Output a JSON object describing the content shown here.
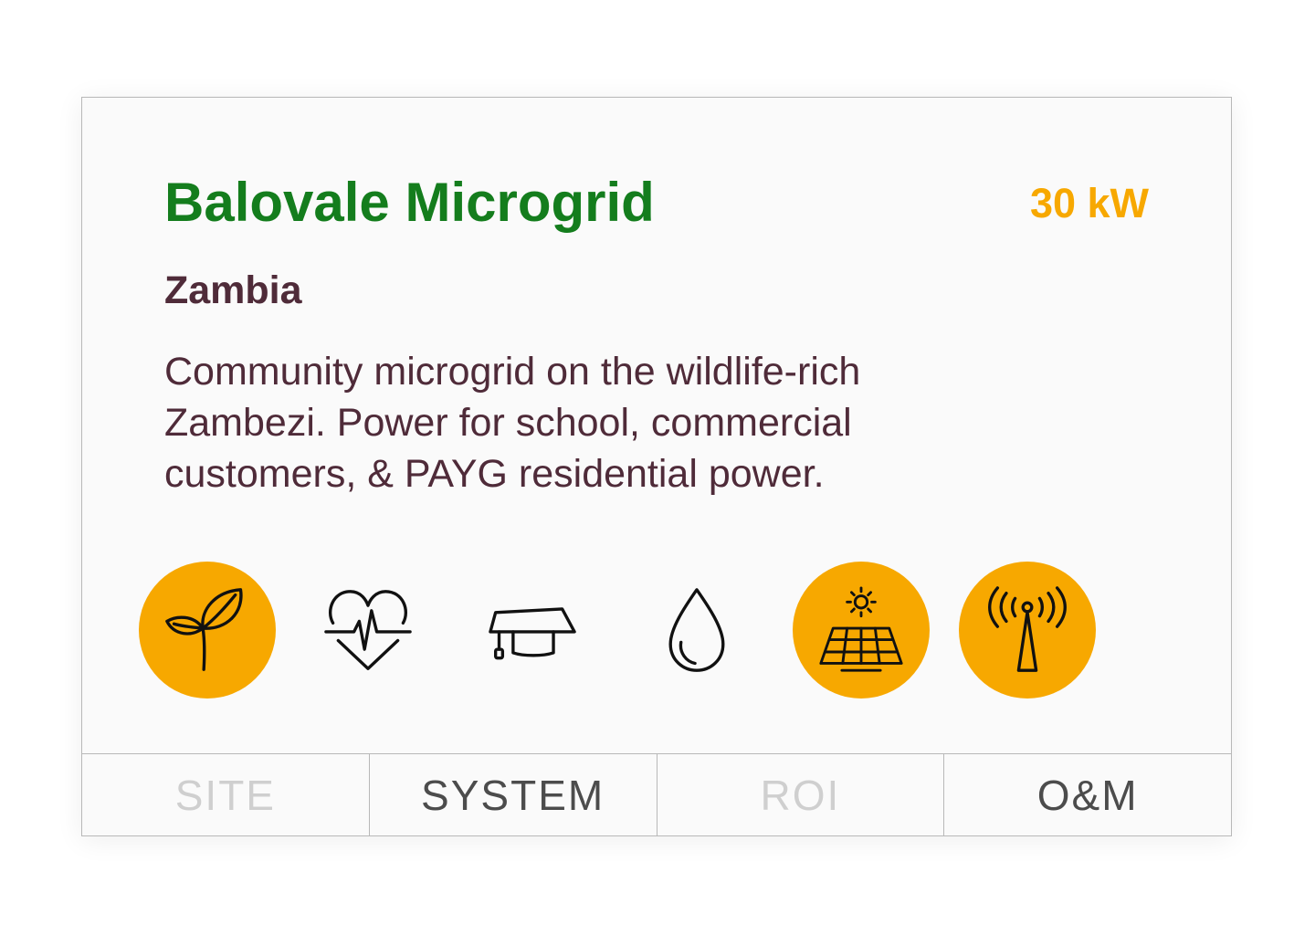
{
  "project": {
    "title": "Balovale Microgrid",
    "power": "30 kW",
    "country": "Zambia",
    "description": "Community microgrid on the wildlife-rich Zambezi. Power for school, commercial customers, & PAYG residential power."
  },
  "impact_icons": [
    {
      "icon": "sprout-icon",
      "active": true
    },
    {
      "icon": "heartbeat-icon",
      "active": false
    },
    {
      "icon": "graduation-cap-icon",
      "active": false
    },
    {
      "icon": "water-drop-icon",
      "active": false
    },
    {
      "icon": "solar-panel-icon",
      "active": true
    },
    {
      "icon": "antenna-icon",
      "active": true
    }
  ],
  "tabs": [
    {
      "label": "SITE",
      "state": "dim"
    },
    {
      "label": "SYSTEM",
      "state": "dark"
    },
    {
      "label": "ROI",
      "state": "dim"
    },
    {
      "label": "O&M",
      "state": "dark"
    }
  ],
  "colors": {
    "title": "#147d1d",
    "power": "#f7a800",
    "body_text": "#4f2b39",
    "active_icon_bg": "#f7a800"
  }
}
